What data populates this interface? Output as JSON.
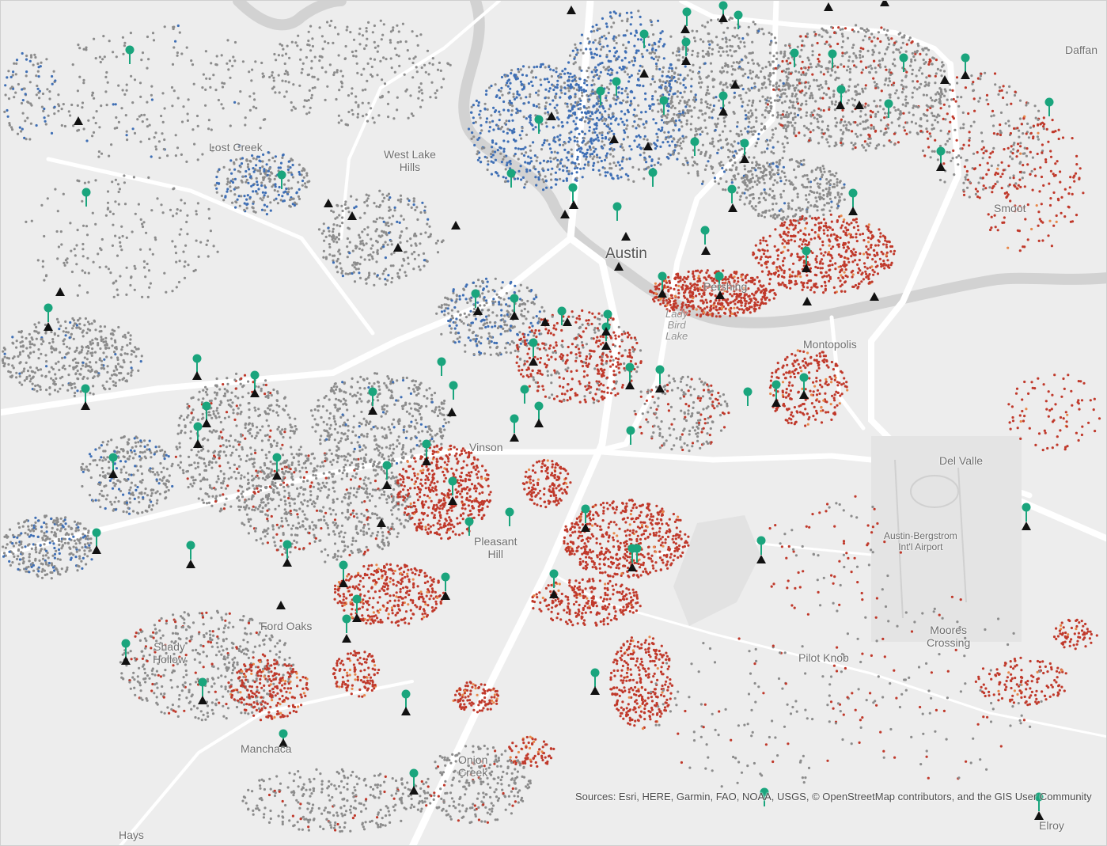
{
  "map": {
    "labels": [
      {
        "id": "lost-creek",
        "text": "Lost Creek"
      },
      {
        "id": "west-lake-hills",
        "text": "West Lake\nHills"
      },
      {
        "id": "austin",
        "text": "Austin"
      },
      {
        "id": "pershing",
        "text": "Pershing"
      },
      {
        "id": "lady-bird-lake",
        "text": "Lady\nBird\nLake"
      },
      {
        "id": "montopolis",
        "text": "Montopolis"
      },
      {
        "id": "vinson",
        "text": "Vinson"
      },
      {
        "id": "pleasant-hill",
        "text": "Pleasant\nHill"
      },
      {
        "id": "ford-oaks",
        "text": "Ford Oaks"
      },
      {
        "id": "shady-hollow",
        "text": "Shady\nHollow"
      },
      {
        "id": "manchaca",
        "text": "Manchaca"
      },
      {
        "id": "onion-creek",
        "text": "Onion\nCreek"
      },
      {
        "id": "hays",
        "text": "Hays"
      },
      {
        "id": "daffan",
        "text": "Daffan"
      },
      {
        "id": "smoot",
        "text": "Smoot"
      },
      {
        "id": "del-valle",
        "text": "Del Valle"
      },
      {
        "id": "austin-bergstrom",
        "text": "Austin-Bergstrom\nInt'l Airport"
      },
      {
        "id": "moores-crossing",
        "text": "Moores\nCrossing"
      },
      {
        "id": "pilot-knob",
        "text": "Pilot Knob"
      },
      {
        "id": "elroy",
        "text": "Elroy"
      }
    ],
    "attribution": "Sources: Esri, HERE, Garmin, FAO, NOAA, USGS, © OpenStreetMap contributors, and the GIS User Community",
    "symbols": {
      "green_pin": "map-pin-icon",
      "black_triangle": "triangle-marker-icon"
    },
    "colors": {
      "background": "#ededed",
      "road": "#ffffff",
      "water": "#d2d2d2",
      "parcel_gray": "#8c8c8c",
      "parcel_blue": "#3f6fb5",
      "parcel_red": "#c0392b",
      "parcel_orange": "#e8884a",
      "pin_green": "#1aa57d",
      "triangle_black": "#111111"
    }
  }
}
